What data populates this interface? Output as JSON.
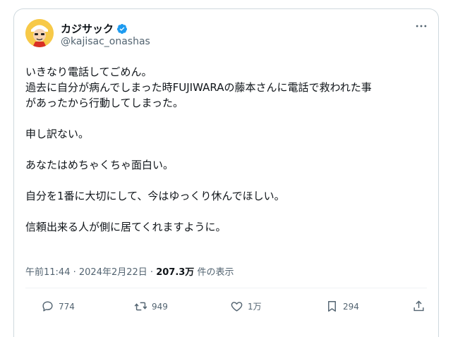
{
  "author": {
    "name": "カジサック",
    "handle": "@kajisac_onashas"
  },
  "post": {
    "lines": [
      "いきなり電話してごめん。",
      "過去に自分が病んでしまった時FUJIWARAの藤本さんに電話で救われた事",
      "があったから行動してしまった。",
      "",
      "申し訳ない。",
      "",
      "あなたはめちゃくちゃ面白い。",
      "",
      "自分を1番に大切にして、今はゆっくり休んでほしい。",
      "",
      "信頼出来る人が側に居てくれますように。"
    ]
  },
  "meta": {
    "time": "午前11:44",
    "separator": " · ",
    "date": "2024年2月22日",
    "views": "207.3万",
    "views_suffix": " 件の表示"
  },
  "actions": {
    "reply_count": "774",
    "repost_count": "949",
    "like_count": "1万",
    "bookmark_count": "294"
  },
  "colors": {
    "verified": "#1d9bf0",
    "muted_text": "#536471",
    "border": "#cfd9de"
  }
}
